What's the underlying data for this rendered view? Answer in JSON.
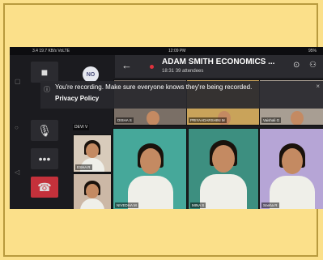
{
  "statusbar": {
    "left": "3.4 19.7 KB/s VoLTE",
    "time": "12:09 PM",
    "right": "95%"
  },
  "header": {
    "title": "ADAM SMITH ECONOMICS ...",
    "duration": "18:31",
    "attendees": "39 attendees"
  },
  "avatar": {
    "initials": "NO"
  },
  "devi_badge": "DEVI V",
  "banner": {
    "message": "You're recording. Make sure everyone knows they're being recorded.",
    "link": "Privacy Policy"
  },
  "tiles": [
    {
      "label": "DISHA S"
    },
    {
      "label": "PRIYAADARSHINI M"
    },
    {
      "label": "Vaishali G"
    },
    {
      "label": "ESHA R"
    },
    {
      "label": "NIVEDHA M"
    },
    {
      "label": "HEMASHREE S"
    },
    {
      "label": "MINA S"
    },
    {
      "label": "Sneha R"
    }
  ],
  "colors": {
    "recording": "#e0323d",
    "hangup": "#c4313b",
    "page_background": "#fbe08a"
  },
  "icons": [
    "video-camera-icon",
    "microphone-icon",
    "more-options-icon",
    "hangup-icon",
    "back-arrow-icon",
    "chat-icon",
    "participants-icon",
    "info-icon",
    "close-icon"
  ]
}
